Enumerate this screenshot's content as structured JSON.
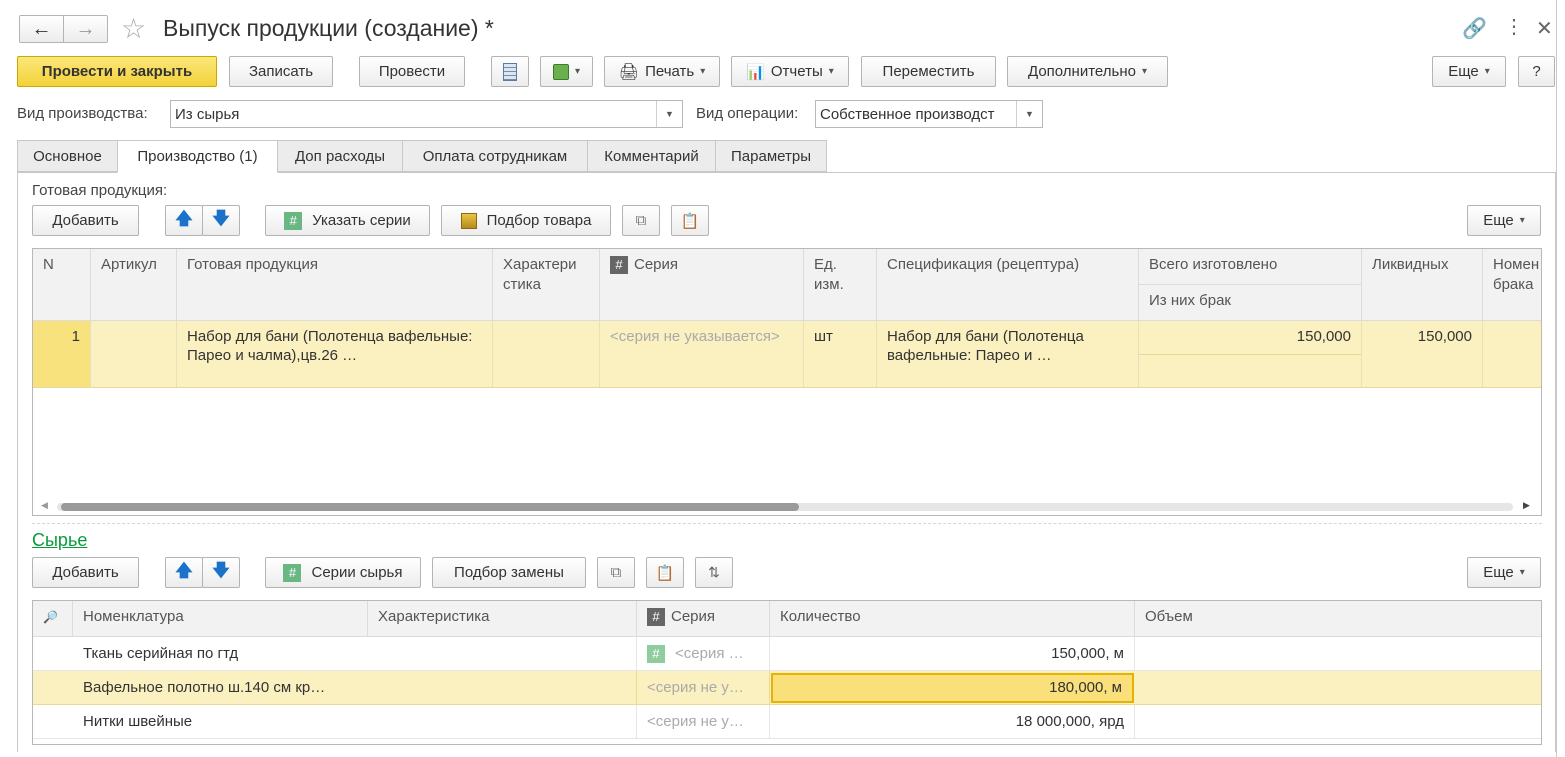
{
  "window": {
    "title": "Выпуск продукции (создание) *"
  },
  "toolbar": {
    "post_close": "Провести и закрыть",
    "write": "Записать",
    "post": "Провести",
    "print": "Печать",
    "reports": "Отчеты",
    "move": "Переместить",
    "more_actions": "Дополнительно",
    "more": "Еще",
    "help": "?"
  },
  "header": {
    "prod_type_label": "Вид производства:",
    "prod_type_value": "Из сырья",
    "op_type_label": "Вид операции:",
    "op_type_value": "Собственное производст"
  },
  "tabs": [
    {
      "label": "Основное"
    },
    {
      "label": "Производство (1)"
    },
    {
      "label": "Доп расходы"
    },
    {
      "label": "Оплата сотрудникам"
    },
    {
      "label": "Комментарий"
    },
    {
      "label": "Параметры"
    }
  ],
  "products": {
    "section_label": "Готовая продукция:",
    "add": "Добавить",
    "series": "Указать серии",
    "pick": "Подбор товара",
    "more": "Еще",
    "columns": {
      "n": "N",
      "article": "Артикул",
      "product": "Готовая продукция",
      "characteristic": "Характери стика",
      "series": "Серия",
      "unit": "Ед. изм.",
      "spec": "Спецификация (рецептура)",
      "total": "Всего изготовлено",
      "defect": "Из них брак",
      "liquid": "Ликвидных",
      "nomen": "Номен брака"
    },
    "rows": [
      {
        "n": "1",
        "article": "",
        "product": "Набор для бани (Полотенца вафельные: Парео и чалма),цв.26 …",
        "characteristic": "",
        "series": "<серия не указывается>",
        "unit": "шт",
        "spec": "Набор для бани (Полотенца вафельные: Парео и …",
        "total": "150,000",
        "defect": "",
        "liquid": "150,000"
      }
    ]
  },
  "raw": {
    "section_label": "Сырье",
    "add": "Добавить",
    "series": "Серии сырья",
    "replace": "Подбор замены",
    "more": "Еще",
    "columns": {
      "nomenclature": "Номенклатура",
      "characteristic": "Характеристика",
      "series": "Серия",
      "quantity": "Количество",
      "volume": "Объем"
    },
    "rows": [
      {
        "nomenclature": "Ткань серийная по гтд",
        "characteristic": "",
        "series": "<серия …",
        "quantity": "150,000, м",
        "volume": ""
      },
      {
        "nomenclature": "Вафельное полотно ш.140 см кр…",
        "characteristic": "",
        "series": "<серия не у…",
        "quantity": "180,000, м",
        "volume": ""
      },
      {
        "nomenclature": "Нитки швейные",
        "characteristic": "",
        "series": "<серия не у…",
        "quantity": "18 000,000, ярд",
        "volume": ""
      }
    ]
  }
}
